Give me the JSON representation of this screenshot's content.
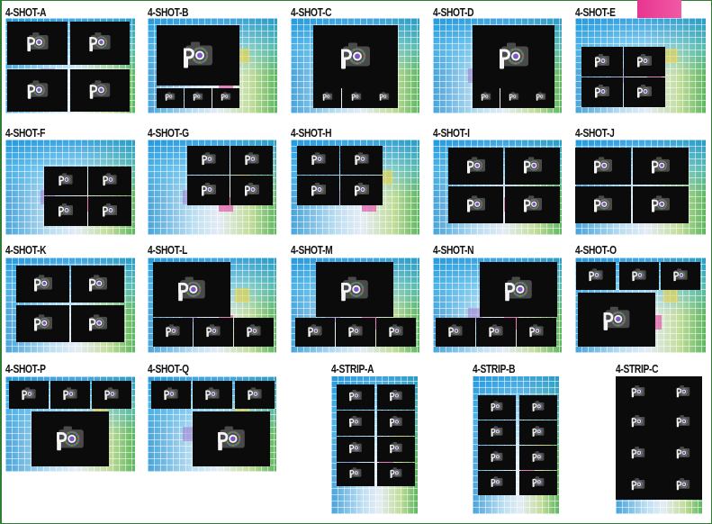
{
  "templates": [
    {
      "id": "a",
      "label": "4-SHOT-A"
    },
    {
      "id": "b",
      "label": "4-SHOT-B"
    },
    {
      "id": "c",
      "label": "4-SHOT-C"
    },
    {
      "id": "d",
      "label": "4-SHOT-D"
    },
    {
      "id": "e",
      "label": "4-SHOT-E"
    },
    {
      "id": "f",
      "label": "4-SHOT-F"
    },
    {
      "id": "g",
      "label": "4-SHOT-G"
    },
    {
      "id": "h",
      "label": "4-SHOT-H"
    },
    {
      "id": "i",
      "label": "4-SHOT-I"
    },
    {
      "id": "j",
      "label": "4-SHOT-J"
    },
    {
      "id": "k",
      "label": "4-SHOT-K"
    },
    {
      "id": "l",
      "label": "4-SHOT-L"
    },
    {
      "id": "m",
      "label": "4-SHOT-M"
    },
    {
      "id": "n",
      "label": "4-SHOT-N"
    },
    {
      "id": "o",
      "label": "4-SHOT-O"
    },
    {
      "id": "p",
      "label": "4-SHOT-P"
    },
    {
      "id": "q",
      "label": "4-SHOT-Q"
    },
    {
      "id": "sa",
      "label": "4-STRIP-A"
    },
    {
      "id": "sb",
      "label": "4-STRIP-B"
    },
    {
      "id": "sc",
      "label": "4-STRIP-C"
    }
  ],
  "placeholder_icon": "camera-icon",
  "colors": {
    "frame_border": "#2e7d32",
    "shot_fill": "#0b0b0b",
    "accent": "#e8358f"
  }
}
